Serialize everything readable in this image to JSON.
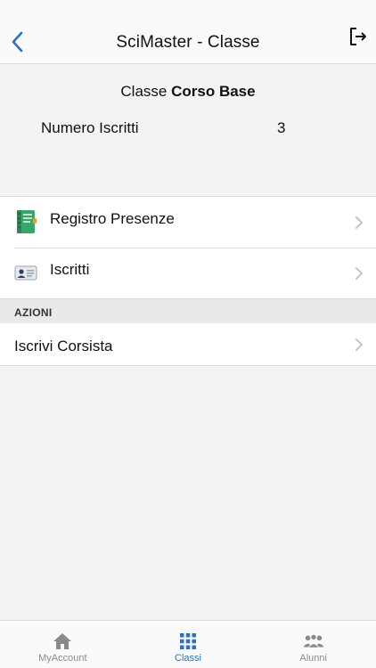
{
  "navbar": {
    "title": "SciMaster - Classe",
    "back_icon": "chevron-left-icon",
    "logout_icon": "logout-icon"
  },
  "class_info": {
    "title_prefix": "Classe",
    "class_name": "Corso Base",
    "enrolled_label": "Numero Iscritti",
    "enrolled_count": "3"
  },
  "menu": {
    "items": [
      {
        "label": "Registro Presenze",
        "icon": "register-book-icon"
      },
      {
        "label": "Iscritti",
        "icon": "id-card-icon"
      }
    ]
  },
  "actions": {
    "header": "AZIONI",
    "items": [
      {
        "label": "Iscrivi Corsista"
      }
    ]
  },
  "tabbar": {
    "tabs": [
      {
        "label": "MyAccount",
        "icon": "home-icon",
        "active": false
      },
      {
        "label": "Classi",
        "icon": "grid-icon",
        "active": true
      },
      {
        "label": "Alunni",
        "icon": "people-icon",
        "active": false
      }
    ]
  },
  "colors": {
    "accent": "#2f6fc2",
    "inactive": "#8a8a8a",
    "background": "#f3f3f3"
  }
}
